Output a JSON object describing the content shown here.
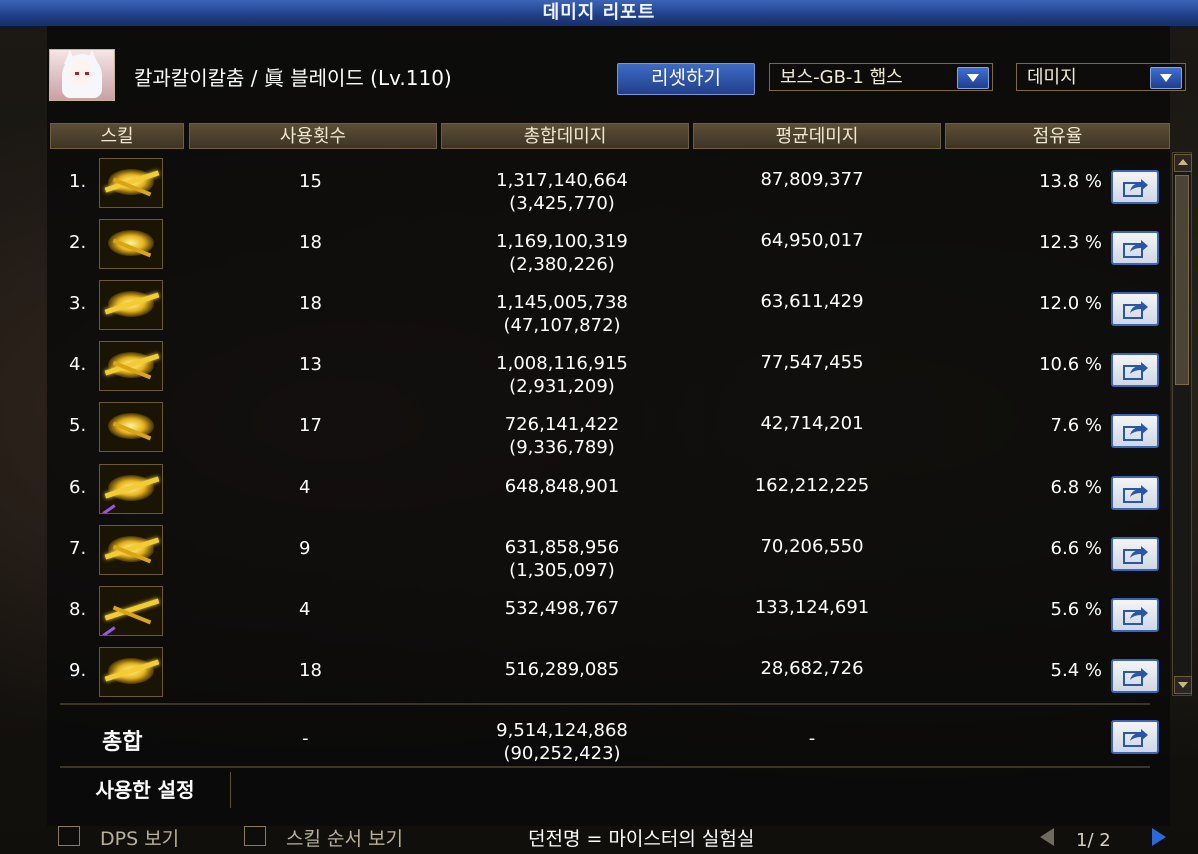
{
  "window": {
    "title": "데미지 리포트"
  },
  "header": {
    "character": "칼과칼이칼춤 / 眞 블레이드 (Lv.110)",
    "reset_label": "리셋하기",
    "dungeon_select": "보스-GB-1 햅스",
    "metric_select": "데미지"
  },
  "columns": [
    "스킬",
    "사용횟수",
    "총합데미지",
    "평균데미지",
    "점유율"
  ],
  "rows": [
    {
      "idx": "1.",
      "uses": "15",
      "total": "1,317,140,664",
      "sub": "(3,425,770)",
      "avg": "87,809,377",
      "share": "13.8 %"
    },
    {
      "idx": "2.",
      "uses": "18",
      "total": "1,169,100,319",
      "sub": "(2,380,226)",
      "avg": "64,950,017",
      "share": "12.3 %"
    },
    {
      "idx": "3.",
      "uses": "18",
      "total": "1,145,005,738",
      "sub": "(47,107,872)",
      "avg": "63,611,429",
      "share": "12.0 %"
    },
    {
      "idx": "4.",
      "uses": "13",
      "total": "1,008,116,915",
      "sub": "(2,931,209)",
      "avg": "77,547,455",
      "share": "10.6 %"
    },
    {
      "idx": "5.",
      "uses": "17",
      "total": "726,141,422",
      "sub": "(9,336,789)",
      "avg": "42,714,201",
      "share": "7.6 %"
    },
    {
      "idx": "6.",
      "uses": "4",
      "total": "648,848,901",
      "sub": "",
      "avg": "162,212,225",
      "share": "6.8 %"
    },
    {
      "idx": "7.",
      "uses": "9",
      "total": "631,858,956",
      "sub": "(1,305,097)",
      "avg": "70,206,550",
      "share": "6.6 %"
    },
    {
      "idx": "8.",
      "uses": "4",
      "total": "532,498,767",
      "sub": "",
      "avg": "133,124,691",
      "share": "5.6 %"
    },
    {
      "idx": "9.",
      "uses": "18",
      "total": "516,289,085",
      "sub": "",
      "avg": "28,682,726",
      "share": "5.4 %"
    }
  ],
  "summary": {
    "label": "총합",
    "uses": "-",
    "total": "9,514,124,868",
    "sub": "(90,252,423)",
    "avg": "-"
  },
  "settings": {
    "label": "사용한 설정"
  },
  "footer": {
    "dps_label": "DPS 보기",
    "order_label": "스킬 순서 보기",
    "dungeon": "던전명 = 마이스터의 실험실",
    "page": "1/ 2"
  },
  "colors": {
    "accent": "#2c5fc0",
    "header": "#4a3f2b"
  }
}
